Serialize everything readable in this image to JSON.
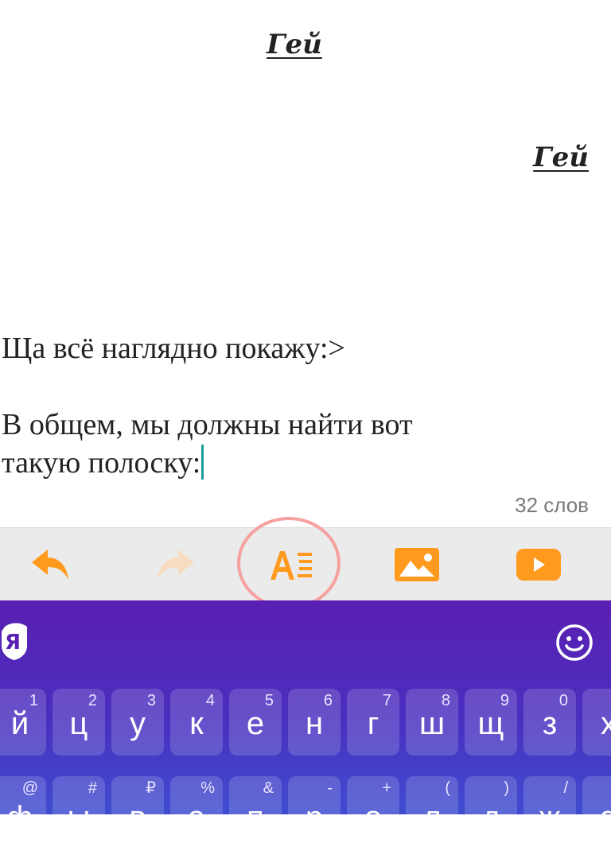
{
  "editor": {
    "heading_center": "Гей",
    "heading_right": "Гей",
    "paragraph_1": "Ща всё наглядно покажу:>",
    "paragraph_2_line_1": "В общем, мы должны найти вот",
    "paragraph_2_line_2": "такую полоску:",
    "word_count": "32 слов"
  },
  "toolbar": {
    "items": [
      {
        "name": "undo",
        "icon": "undo-arrow-icon",
        "enabled": true
      },
      {
        "name": "redo",
        "icon": "redo-arrow-icon",
        "enabled": false
      },
      {
        "name": "text-format",
        "icon": "text-format-icon",
        "enabled": true,
        "highlighted": true
      },
      {
        "name": "insert-image",
        "icon": "image-icon",
        "enabled": true
      },
      {
        "name": "insert-video",
        "icon": "youtube-play-icon",
        "enabled": true
      }
    ],
    "accent_color": "#ff9a1f",
    "disabled_color": "#f8dcc0",
    "highlight_color": "#f6a1a0"
  },
  "keyboard": {
    "logo": "Я",
    "emoji_icon": "smiley-icon",
    "row1": [
      {
        "main": "й",
        "alt": "1"
      },
      {
        "main": "ц",
        "alt": "2"
      },
      {
        "main": "у",
        "alt": "3"
      },
      {
        "main": "к",
        "alt": "4"
      },
      {
        "main": "е",
        "alt": "5"
      },
      {
        "main": "н",
        "alt": "6"
      },
      {
        "main": "г",
        "alt": "7"
      },
      {
        "main": "ш",
        "alt": "8"
      },
      {
        "main": "щ",
        "alt": "9"
      },
      {
        "main": "з",
        "alt": "0"
      },
      {
        "main": "х",
        "alt": ""
      }
    ],
    "row2": [
      {
        "main": "ф",
        "alt": "@"
      },
      {
        "main": "ы",
        "alt": "#"
      },
      {
        "main": "в",
        "alt": "₽"
      },
      {
        "main": "а",
        "alt": "%"
      },
      {
        "main": "п",
        "alt": "&"
      },
      {
        "main": "р",
        "alt": "-"
      },
      {
        "main": "о",
        "alt": "+"
      },
      {
        "main": "л",
        "alt": "("
      },
      {
        "main": "д",
        "alt": ")"
      },
      {
        "main": "ж",
        "alt": "/"
      },
      {
        "main": "э",
        "alt": ""
      }
    ],
    "background_top": "#5a1fb3",
    "background_bottom": "#3f4dd0"
  }
}
